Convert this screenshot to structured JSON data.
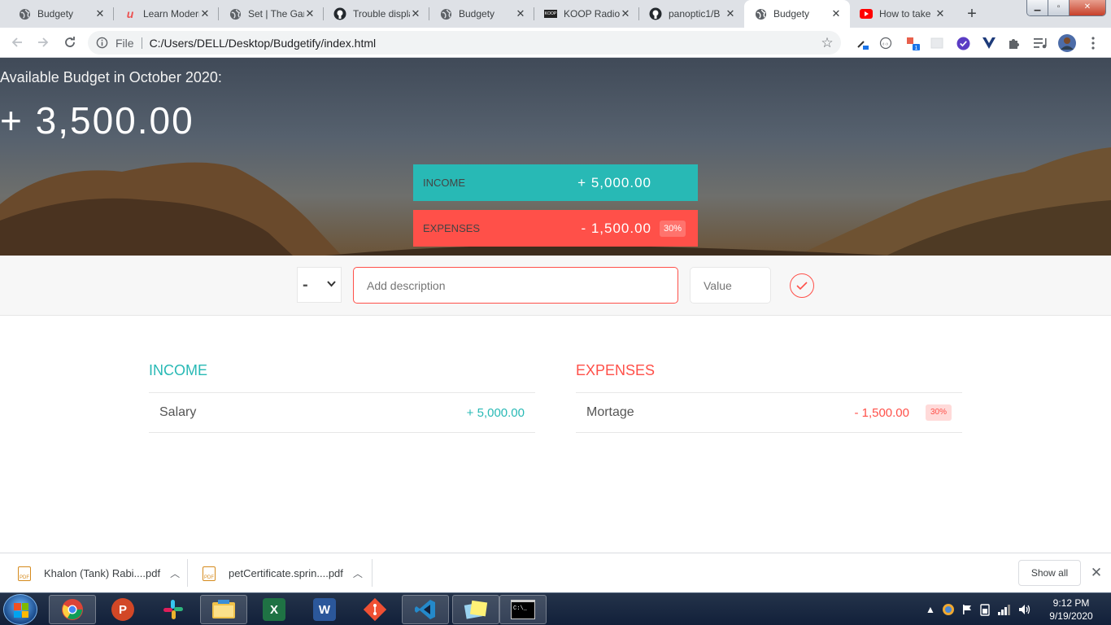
{
  "browser": {
    "tabs": [
      {
        "title": "Budgety",
        "icon": "globe-icon",
        "active": false
      },
      {
        "title": "Learn Modern",
        "icon": "udemy-icon",
        "active": false
      },
      {
        "title": "Set | The Game",
        "icon": "globe-icon",
        "active": false
      },
      {
        "title": "Trouble display",
        "icon": "github-icon",
        "active": false
      },
      {
        "title": "Budgety",
        "icon": "globe-icon",
        "active": false
      },
      {
        "title": "KOOP Radio",
        "icon": "koop-icon",
        "active": false
      },
      {
        "title": "panoptic1/B",
        "icon": "github-icon",
        "active": false
      },
      {
        "title": "Budgety",
        "icon": "globe-icon",
        "active": true
      },
      {
        "title": "How to take",
        "icon": "youtube-icon",
        "active": false
      }
    ],
    "new_tab": "+",
    "address": {
      "scheme": "File",
      "url": "C:/Users/DELL/Desktop/Budgetify/index.html"
    }
  },
  "app": {
    "budget_title": "Available Budget in October 2020:",
    "budget_value": "+ 3,500.00",
    "income_label": "Income",
    "income_value": "+ 5,000.00",
    "expenses_label": "Expenses",
    "expenses_value": "- 1,500.00",
    "expenses_percentage": "30%",
    "add": {
      "type_value": "-",
      "description_placeholder": "Add description",
      "value_placeholder": "Value"
    },
    "income_list": {
      "title": "Income",
      "items": [
        {
          "description": "Salary",
          "value": "+ 5,000.00"
        }
      ]
    },
    "expenses_list": {
      "title": "Expenses",
      "items": [
        {
          "description": "Mortage",
          "value": "- 1,500.00",
          "percentage": "30%"
        }
      ]
    },
    "colors": {
      "income": "#28b9b5",
      "expenses": "#ff5049"
    }
  },
  "downloads": {
    "items": [
      {
        "name": "Khalon (Tank) Rabi....pdf"
      },
      {
        "name": "petCertificate.sprin....pdf"
      }
    ],
    "show_all": "Show all"
  },
  "taskbar": {
    "apps": [
      "chrome-icon",
      "powerpoint-icon",
      "slack-icon",
      "file-explorer-icon",
      "excel-icon",
      "word-icon",
      "git-icon",
      "vscode-icon",
      "sticky-notes-icon",
      "cmd-icon"
    ],
    "time": "9:12 PM",
    "date": "9/19/2020"
  }
}
